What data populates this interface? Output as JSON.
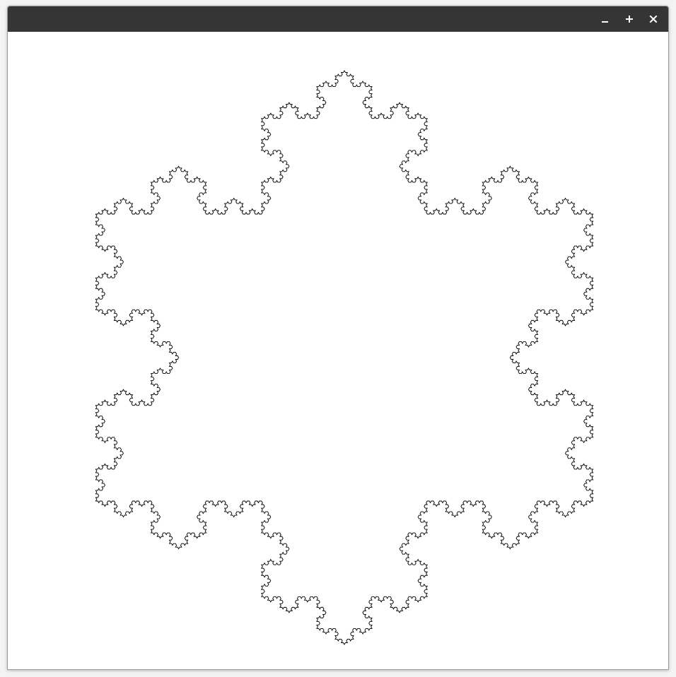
{
  "window": {
    "title": ""
  },
  "controls": {
    "icons": [
      "minimize-icon",
      "maximize-icon",
      "close-icon"
    ],
    "icon_color": "#ffffff"
  },
  "colors": {
    "titlebar": "#353535",
    "canvas_background": "#ffffff",
    "stroke": "#000000"
  },
  "drawing": {
    "shape": "koch-snowflake",
    "iterations": 5
  }
}
